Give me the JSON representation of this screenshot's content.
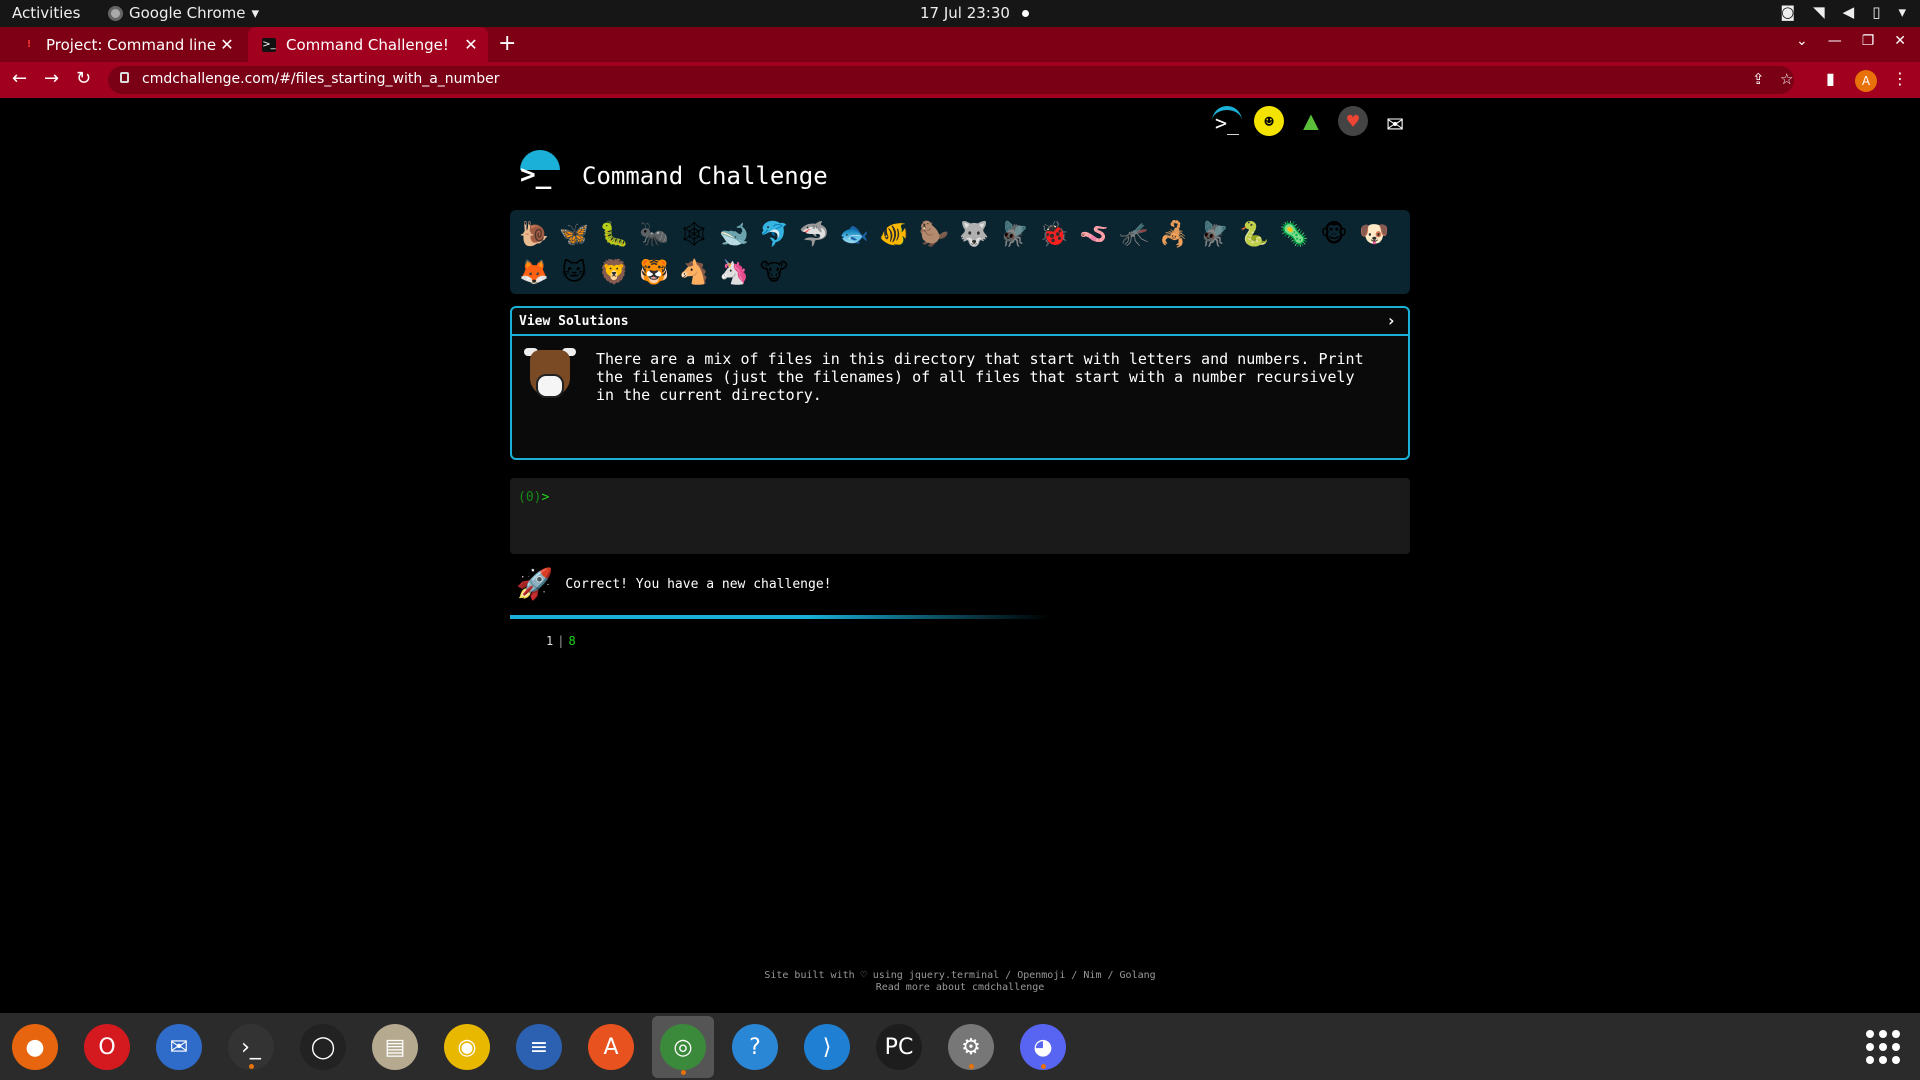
{
  "system_bar": {
    "activities": "Activities",
    "app_name": "Google Chrome",
    "clock": "17 Jul  23:30"
  },
  "tabs": [
    {
      "label": "Project: Command line fo",
      "active": false
    },
    {
      "label": "Command Challenge!",
      "active": true
    }
  ],
  "address_bar": {
    "url": "cmdchallenge.com/#/files_starting_with_a_number",
    "profile_initial": "A"
  },
  "site": {
    "title": "Command Challenge",
    "solutions_label": "View Solutions",
    "challenge_text": "There are a mix of files in this directory that start with letters and numbers. Print the filenames (just the filenames) of all files that start with a number recursively in the current directory.",
    "terminal_prompt_count": "(0)",
    "terminal_prompt_symbol": ">",
    "result_message": "Correct! You have a new challenge!",
    "output_line_number": "1",
    "output_value": "8",
    "footer_line1": "Site built with ♡ using jquery.terminal / Openmoji / Nim / Golang",
    "footer_line2": "Read more about cmdchallenge",
    "progress_fraction": 0.8
  },
  "emoji_icons": [
    "snail-icon",
    "butterfly-icon",
    "caterpillar-icon",
    "ant-icon",
    "spider-web-icon",
    "whale-icon",
    "dolphin-icon",
    "shark-icon",
    "fish-icon",
    "tropical-fish-icon",
    "beaver-icon",
    "wolf-icon",
    "fly-icon",
    "ladybug-icon",
    "worm-icon",
    "mosquito-icon",
    "scorpion-icon",
    "fly-icon",
    "snake-icon",
    "microbe-icon",
    "monkey-icon",
    "dog-icon",
    "fox-icon",
    "cat-icon",
    "lion-icon",
    "tiger-icon",
    "horse-icon",
    "unicorn-icon",
    "cow-icon"
  ],
  "dock_apps": [
    "firefox-icon",
    "opera-icon",
    "thunderbird-icon",
    "terminal-icon",
    "opera-gx-icon",
    "files-icon",
    "rhythmbox-icon",
    "text-editor-icon",
    "app-center-icon",
    "chrome-icon",
    "help-icon",
    "vscode-icon",
    "pycharm-icon",
    "settings-icon",
    "discord-icon"
  ]
}
